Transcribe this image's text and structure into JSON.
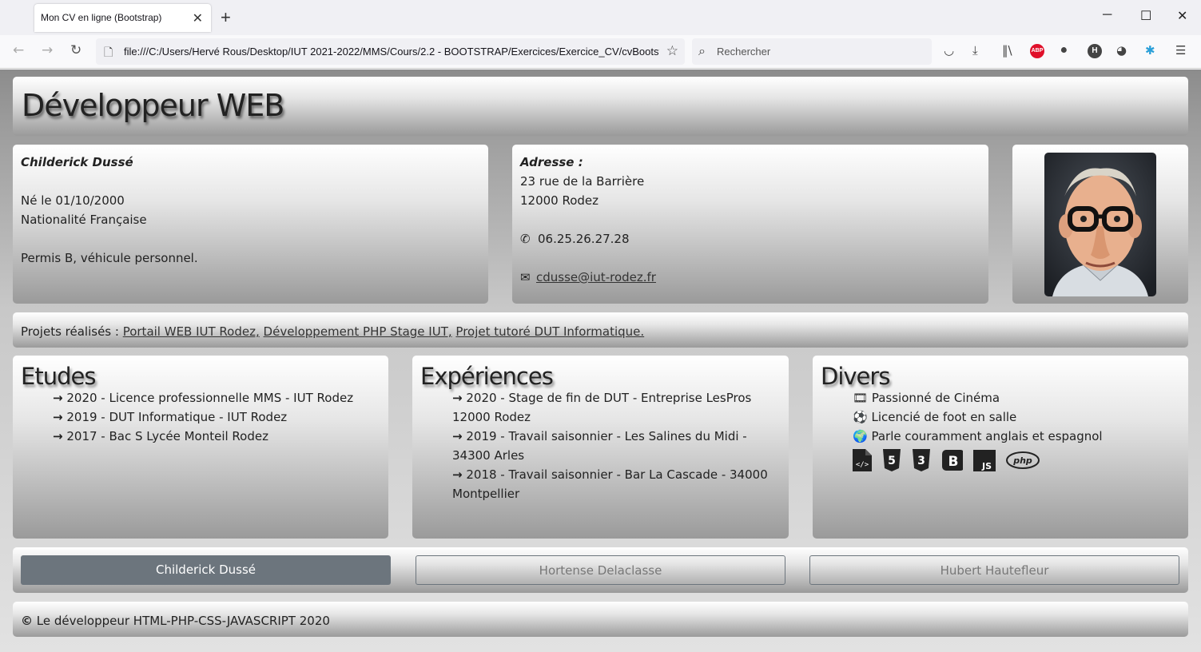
{
  "browser": {
    "tab_title": "Mon CV en ligne (Bootstrap)",
    "tab_close": "✕",
    "new_tab": "+",
    "url": "file:///C:/Users/Hervé Rous/Desktop/IUT 2021-2022/MMS/Cours/2.2 - BOOTSTRAP/Exercices/Exercice_CV/cvBootstrap.html",
    "search_placeholder": "Rechercher",
    "abp_label": "ABP",
    "h_label": "H"
  },
  "page": {
    "title": "Développeur WEB",
    "identity": {
      "name": "Childerick Dussé",
      "birth": "Né le 01/10/2000",
      "nationality": "Nationalité Française",
      "license": "Permis B, véhicule personnel."
    },
    "address": {
      "label": "Adresse :",
      "street": "23 rue de la Barrière",
      "city": "12000 Rodez",
      "phone": "06.25.26.27.28",
      "email": "cdusse@iut-rodez.fr"
    },
    "projects": {
      "label": "Projets réalisés : ",
      "items": [
        "Portail WEB IUT Rodez,",
        "Développement PHP Stage IUT,",
        "Projet tutoré DUT Informatique."
      ]
    },
    "etudes": {
      "title": "Etudes",
      "items": [
        "2020 - Licence professionnelle MMS - IUT Rodez",
        "2019 - DUT Informatique - IUT Rodez",
        "2017 - Bac S Lycée Monteil Rodez"
      ]
    },
    "experiences": {
      "title": "Expériences",
      "items": [
        "2020 - Stage de fin de DUT - Entreprise LesPros 12000 Rodez",
        "2019 - Travail saisonnier - Les Salines du Midi - 34300 Arles",
        "2018 - Travail saisonnier - Bar La Cascade - 34000 Montpellier"
      ]
    },
    "divers": {
      "title": "Divers",
      "items": [
        "Passionné de Cinéma",
        "Licencié de foot en salle",
        "Parle couramment anglais et espagnol"
      ],
      "tech_icons": [
        "code-file-icon",
        "html5-icon",
        "css3-icon",
        "bootstrap-icon",
        "js-icon",
        "php-icon"
      ],
      "tech_labels": {
        "html5": "5",
        "css3": "3",
        "bootstrap": "B",
        "js": "JS",
        "php": "php"
      }
    },
    "buttons": [
      "Childerick Dussé",
      "Hortense Delaclasse",
      "Hubert Hautefleur"
    ],
    "footer": "Le développeur HTML-PHP-CSS-JAVASCRIPT 2020"
  },
  "colors": {
    "button_active": "#6c757d",
    "abp": "#e0102a"
  }
}
